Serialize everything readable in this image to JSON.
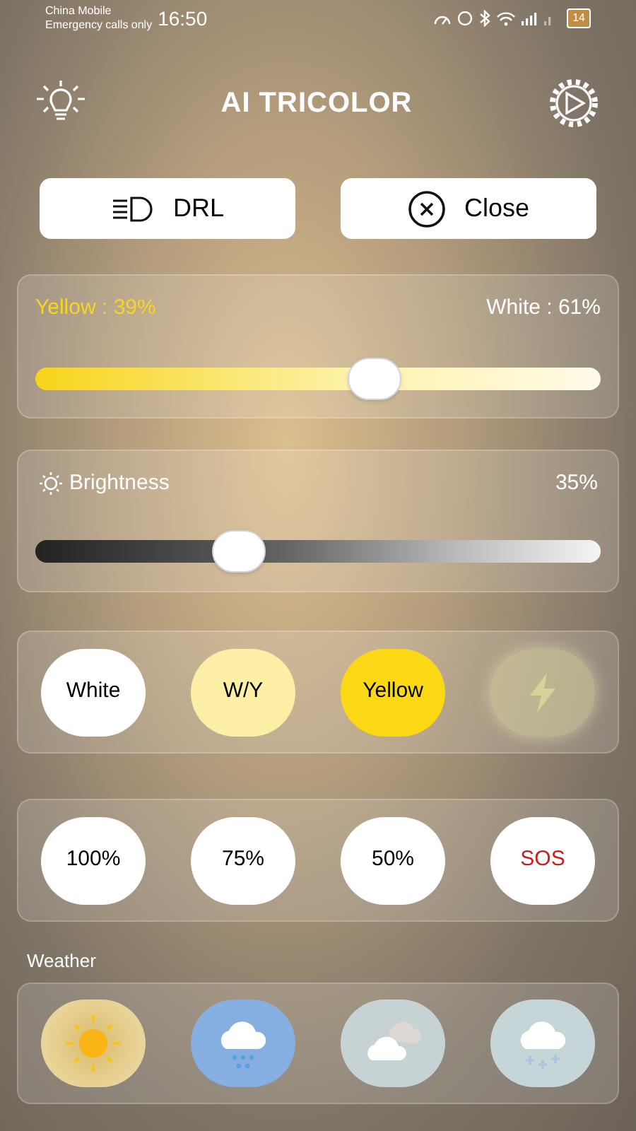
{
  "status_bar": {
    "carrier": "China Mobile",
    "note": "Emergency calls only",
    "time": "16:50",
    "battery": "14"
  },
  "header": {
    "title": "AI TRICOLOR"
  },
  "buttons": [
    {
      "label": "DRL",
      "kind": "drl"
    },
    {
      "label": "Close",
      "kind": "close"
    }
  ],
  "mix": {
    "left_label": "Yellow : 39%",
    "right_label": "White : 61%",
    "level": 0.6
  },
  "brightness": {
    "label": "Brightness",
    "reading": "35%",
    "level": 0.36
  },
  "color_modes": [
    {
      "label": "White",
      "kind": "white"
    },
    {
      "label": "W/Y",
      "kind": "wy"
    },
    {
      "label": "Yellow",
      "kind": "yellow"
    },
    {
      "kind": "flash"
    }
  ],
  "presets": [
    {
      "label": "100%",
      "kind": "level"
    },
    {
      "label": "75%",
      "kind": "level"
    },
    {
      "label": "50%",
      "kind": "level"
    },
    {
      "label": "SOS",
      "kind": "sos"
    }
  ],
  "weather": {
    "label": "Weather",
    "items": [
      {
        "kind": "sunny"
      },
      {
        "kind": "rain"
      },
      {
        "kind": "cloudy"
      },
      {
        "kind": "snow"
      }
    ]
  }
}
